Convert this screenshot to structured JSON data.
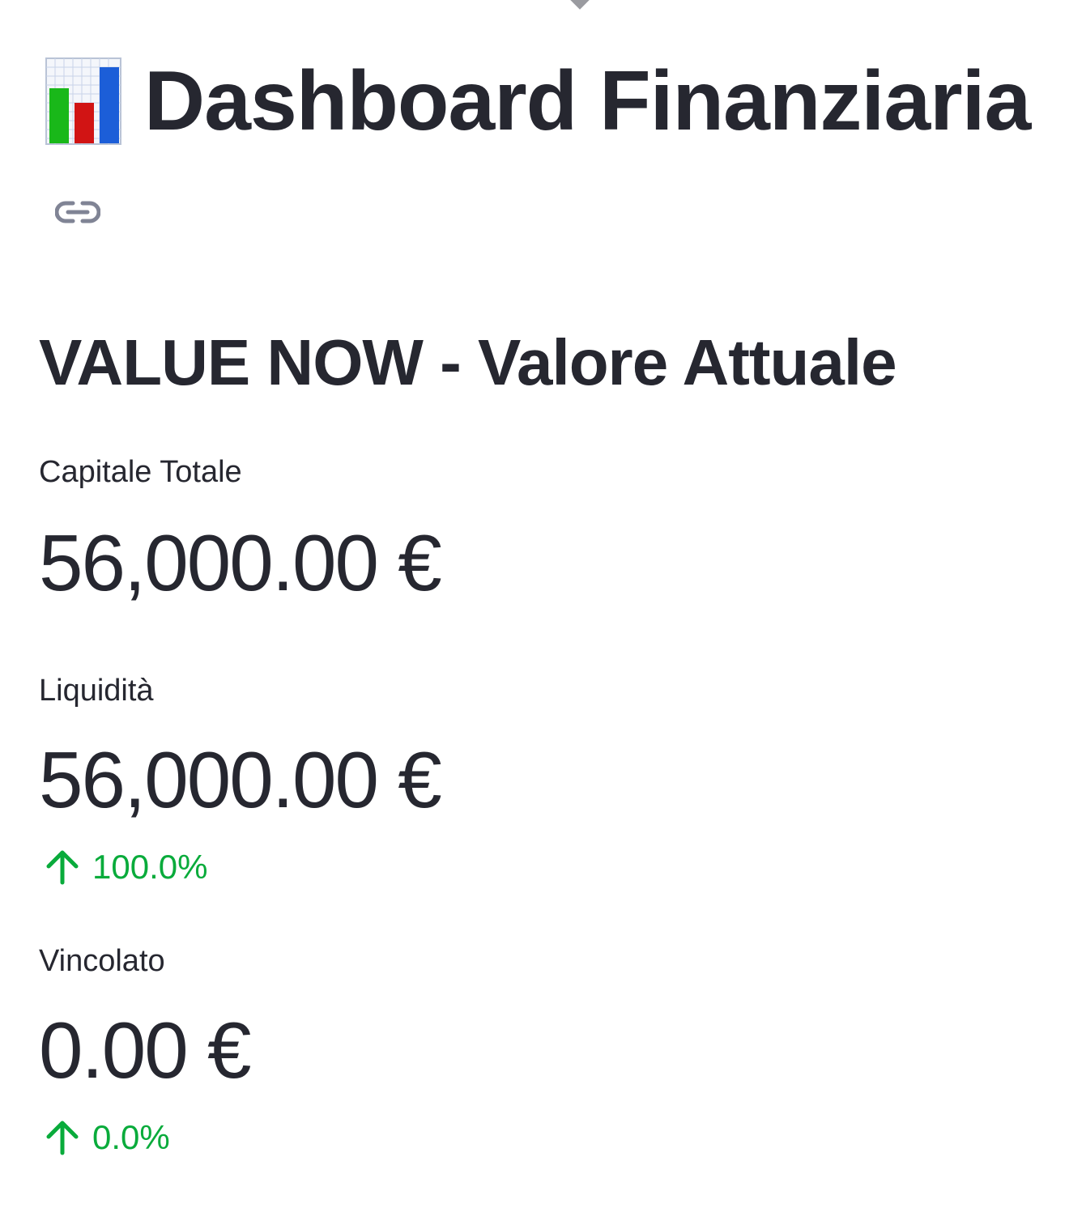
{
  "header": {
    "title": "Dashboard Finanziaria",
    "title_icon": "bar-chart-emoji",
    "anchor_icon": "link-icon"
  },
  "section": {
    "heading": "VALUE NOW - Valore Attuale"
  },
  "metrics": [
    {
      "label": "Capitale Totale",
      "value": "56,000.00 €",
      "delta": ""
    },
    {
      "label": "Liquidità",
      "value": "56,000.00 €",
      "delta": "100.0%",
      "delta_direction": "up"
    },
    {
      "label": "Vincolato",
      "value": "0.00 €",
      "delta": "0.0%",
      "delta_direction": "up"
    }
  ],
  "colors": {
    "text": "#262730",
    "delta_positive": "#09ab3b",
    "muted_icon": "#808495"
  }
}
